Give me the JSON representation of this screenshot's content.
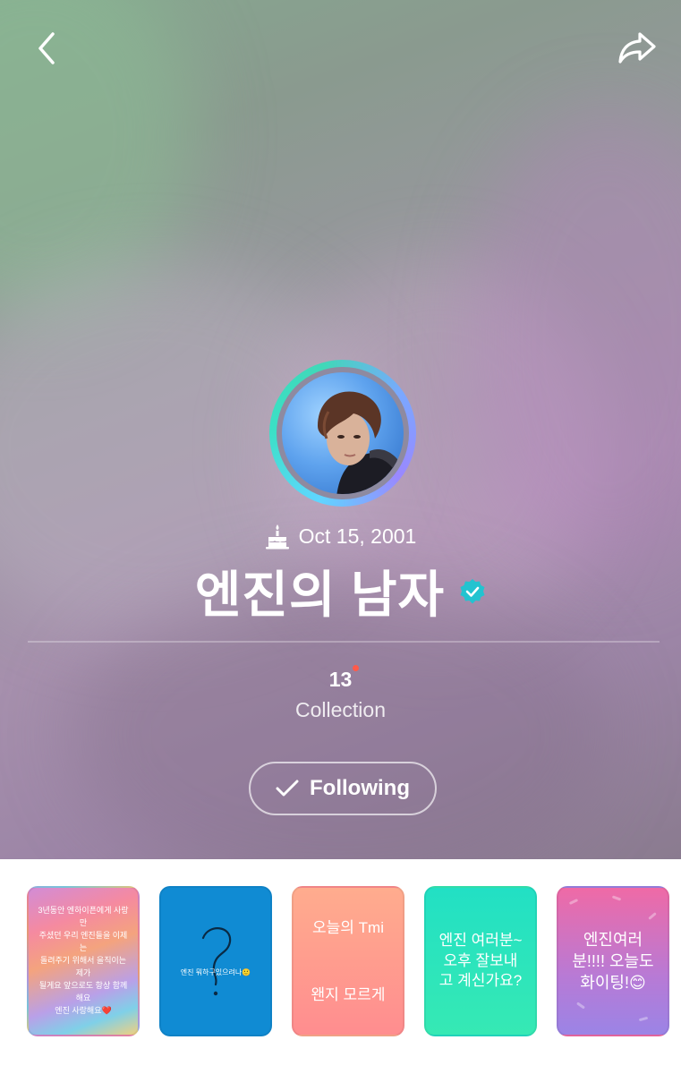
{
  "header": {
    "back_icon": "chevron-left-icon",
    "share_icon": "share-forward-icon"
  },
  "profile": {
    "avatar_alt": "profile photo",
    "birthday_icon": "birthday-cake-icon",
    "birthday": "Oct 15, 2001",
    "name": "엔진의 남자",
    "verified_icon": "verified-badge-icon",
    "collection_count": "13",
    "collection_label": "Collection",
    "follow_button": {
      "label": "Following",
      "icon": "checkmark-icon"
    }
  },
  "colors": {
    "verified": "#22c3d0",
    "notification_dot": "#ff5a4a"
  },
  "collections": [
    {
      "text": "3년동안 엔하이픈에게 사랑만\n주셨던 우리 엔진들을 이제는\n돌려주기 위해서 을직이는 제가\n될게요 앞으로도 항상 함께해요\n엔진 사랑해요❤️"
    },
    {
      "text": "엔진 뭐하구있으려나🙂"
    },
    {
      "text": "오늘의 Tmi\n\n왠지 모르게"
    },
    {
      "text": "엔진 여러분~\n오후 잘보내\n고 계신가요?"
    },
    {
      "text": "엔진여러\n분!!!! 오늘도\n화이팅!😊"
    }
  ]
}
